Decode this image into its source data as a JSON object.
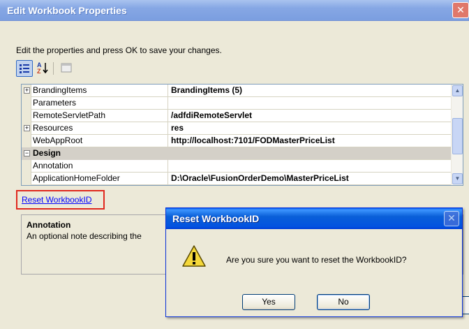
{
  "window": {
    "title": "Edit Workbook Properties",
    "close_glyph": "✕",
    "intro_text": "Edit the properties and press OK to save your changes."
  },
  "toolbar": {
    "categorized_icon": "categorized-icon",
    "alphabetical_icon": "alphabetical-icon",
    "property_pages_icon": "property-pages-icon"
  },
  "property_grid": {
    "rows": [
      {
        "name": "BrandingItems",
        "value": "BrandingItems (5)",
        "expandable": true
      },
      {
        "name": "Parameters",
        "value": "",
        "expandable": false
      },
      {
        "name": "RemoteServletPath",
        "value": "/adfdiRemoteServlet",
        "expandable": false
      },
      {
        "name": "Resources",
        "value": "res",
        "expandable": true
      },
      {
        "name": "WebAppRoot",
        "value": "http://localhost:7101/FODMasterPriceList",
        "expandable": false
      },
      {
        "name": "Design",
        "value": "",
        "category": true
      },
      {
        "name": "Annotation",
        "value": "",
        "expandable": false
      },
      {
        "name": "ApplicationHomeFolder",
        "value": "D:\\Oracle\\FusionOrderDemo\\MasterPriceList",
        "expandable": false
      }
    ],
    "expand_glyph": "+",
    "collapse_glyph": "−"
  },
  "reset_link": "Reset WorkbookID",
  "description": {
    "title": "Annotation",
    "text": "An optional note describing the"
  },
  "dialog": {
    "title": "Reset WorkbookID",
    "close_glyph": "✕",
    "message": "Are you sure you want to reset the WorkbookID?",
    "yes_label": "Yes",
    "no_label": "No",
    "icon": "warning-icon"
  },
  "colors": {
    "dialog_title_blue": "#0a5fd8",
    "window_title_blue": "#86a7e4",
    "highlight_red": "#e0281e",
    "link_blue": "#0000ff"
  }
}
